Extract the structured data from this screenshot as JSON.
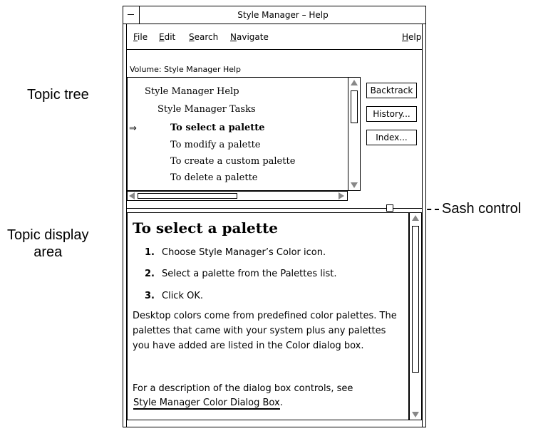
{
  "callouts": {
    "topic_tree": "Topic tree",
    "topic_display_line1": "Topic display",
    "topic_display_line2": "area",
    "sash_control": "Sash control"
  },
  "window": {
    "title": "Style Manager – Help"
  },
  "menubar": {
    "file": "File",
    "edit": "Edit",
    "search": "Search",
    "navigate": "Navigate",
    "help": "Help"
  },
  "volume": {
    "label": "Volume:",
    "value": "Style Manager Help"
  },
  "tree": {
    "items": [
      {
        "label": "Style Manager Help"
      },
      {
        "label": "Style Manager Tasks"
      },
      {
        "label": "To select a palette"
      },
      {
        "label": "To modify a palette"
      },
      {
        "label": "To create a custom palette"
      },
      {
        "label": "To delete a palette"
      }
    ],
    "current_marker": "⇒"
  },
  "buttons": {
    "backtrack": "Backtrack",
    "history": "History...",
    "index": "Index..."
  },
  "topic": {
    "title": "To select a palette",
    "steps": [
      {
        "num": "1.",
        "text": "Choose Style Manager’s Color icon."
      },
      {
        "num": "2.",
        "text": "Select a palette from the Palettes list."
      },
      {
        "num": "3.",
        "text": "Click OK."
      }
    ],
    "paragraph1": "Desktop colors come from predefined color palettes. The palettes that came with your system plus any palettes you have added are listed in the Color dialog box.",
    "paragraph2": "For a description of the dialog box controls, see",
    "link": "Style Manager Color Dialog Box",
    "link_suffix": "."
  }
}
